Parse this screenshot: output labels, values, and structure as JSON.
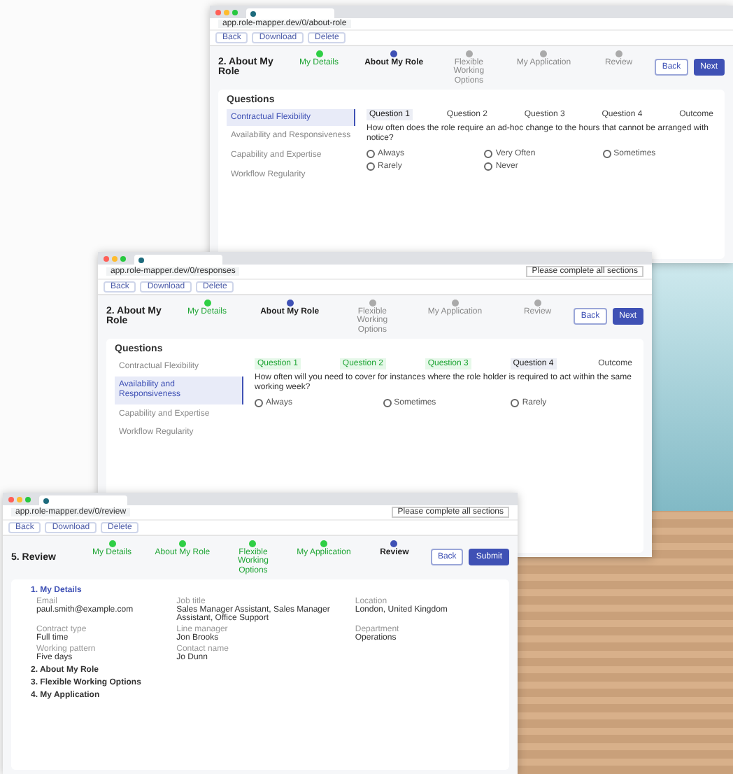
{
  "windows": [
    {
      "url": "app.role-mapper.dev/0/about-role",
      "toolbar": [
        "Back",
        "Download",
        "Delete"
      ],
      "title": "2. About My Role",
      "back": "Back",
      "next": "Next",
      "steps": [
        {
          "label": "My Details",
          "completed": true,
          "selected": false
        },
        {
          "label": "About My Role",
          "completed": false,
          "selected": true
        },
        {
          "label": "Flexible Working Options",
          "completed": false,
          "selected": false
        },
        {
          "label": "My Application",
          "completed": false,
          "selected": false
        },
        {
          "label": "Review",
          "completed": false,
          "selected": false
        }
      ],
      "content": {
        "kind": "questions",
        "heading": "Questions",
        "items": [
          {
            "label": "Contractual Flexibility",
            "selected": true
          },
          {
            "label": "Availability and Responsiveness",
            "selected": false
          },
          {
            "label": "Capability and Expertise",
            "selected": false
          },
          {
            "label": "Workflow Regularity",
            "selected": false
          }
        ],
        "tabs": [
          {
            "label": "Question 1",
            "completed": false,
            "selected": true
          },
          {
            "label": "Question 2",
            "completed": false,
            "selected": false
          },
          {
            "label": "Question 3",
            "completed": false,
            "selected": false
          },
          {
            "label": "Question 4",
            "completed": false,
            "selected": false
          },
          {
            "label": "Outcome",
            "completed": false,
            "selected": false
          }
        ],
        "question": "How often does the role require an ad-hoc change to the hours that cannot be arranged with notice?",
        "options": [
          {
            "label": "Always",
            "checked": false
          },
          {
            "label": "Very Often",
            "checked": false
          },
          {
            "label": "Sometimes",
            "checked": false
          },
          {
            "label": "Rarely",
            "checked": false
          },
          {
            "label": "Never",
            "checked": false
          }
        ]
      }
    },
    {
      "url": "app.role-mapper.dev/0/responses",
      "toolbar": [
        "Back",
        "Download",
        "Delete"
      ],
      "footer_note": "Please complete all sections",
      "title": "2. About My Role",
      "back": "Back",
      "next": "Next",
      "steps": [
        {
          "label": "My Details",
          "completed": true,
          "selected": false
        },
        {
          "label": "About My Role",
          "completed": false,
          "selected": true
        },
        {
          "label": "Flexible Working Options",
          "completed": false,
          "selected": false
        },
        {
          "label": "My Application",
          "completed": false,
          "selected": false
        },
        {
          "label": "Review",
          "completed": false,
          "selected": false
        }
      ],
      "content": {
        "kind": "questions",
        "heading": "Questions",
        "items": [
          {
            "label": "Contractual Flexibility",
            "selected": false
          },
          {
            "label": "Availability and Responsiveness",
            "selected": true
          },
          {
            "label": "Capability and Expertise",
            "selected": false
          },
          {
            "label": "Workflow Regularity",
            "selected": false
          }
        ],
        "tabs": [
          {
            "label": "Question 1",
            "completed": true,
            "selected": false
          },
          {
            "label": "Question 2",
            "completed": true,
            "selected": false
          },
          {
            "label": "Question 3",
            "completed": true,
            "selected": false
          },
          {
            "label": "Question 4",
            "completed": false,
            "selected": true
          },
          {
            "label": "Outcome",
            "completed": false,
            "selected": false
          }
        ],
        "question": "How often will you need to cover for instances where the role holder is required to act within the same working week?",
        "options": [
          {
            "label": "Always",
            "checked": false
          },
          {
            "label": "Sometimes",
            "checked": false
          },
          {
            "label": "Rarely",
            "checked": false
          }
        ]
      }
    },
    {
      "url": "app.role-mapper.dev/0/review",
      "toolbar": [
        "Back",
        "Download",
        "Delete"
      ],
      "footer_note": "Please complete all sections",
      "title": "5. Review",
      "back": "Back",
      "next": "Submit",
      "steps": [
        {
          "label": "My Details",
          "completed": true,
          "selected": false
        },
        {
          "label": "About My Role",
          "completed": true,
          "selected": false
        },
        {
          "label": "Flexible Working Options",
          "completed": true,
          "selected": false
        },
        {
          "label": "My Application",
          "completed": true,
          "selected": false
        },
        {
          "label": "Review",
          "completed": false,
          "selected": true
        }
      ],
      "content": {
        "kind": "review",
        "sections": [
          {
            "label": "1. My Details",
            "expanded": true,
            "fields": [
              {
                "label": "Email",
                "value": "paul.smith@example.com"
              },
              {
                "label": "Job title",
                "value": "Sales Manager Assistant, Sales Manager Assistant, Office Support"
              },
              {
                "label": "Location",
                "value": "London, United Kingdom"
              },
              {
                "label": "Contract type",
                "value": "Full time"
              },
              {
                "label": "Line manager",
                "value": "Jon Brooks"
              },
              {
                "label": "Department",
                "value": "Operations"
              },
              {
                "label": "Working pattern",
                "value": "Five days"
              },
              {
                "label": "Contact name",
                "value": "Jo Dunn"
              }
            ]
          },
          {
            "label": "2. About My Role",
            "expanded": false
          },
          {
            "label": "3. Flexible Working Options",
            "expanded": false
          },
          {
            "label": "4. My Application",
            "expanded": false
          }
        ]
      }
    }
  ]
}
